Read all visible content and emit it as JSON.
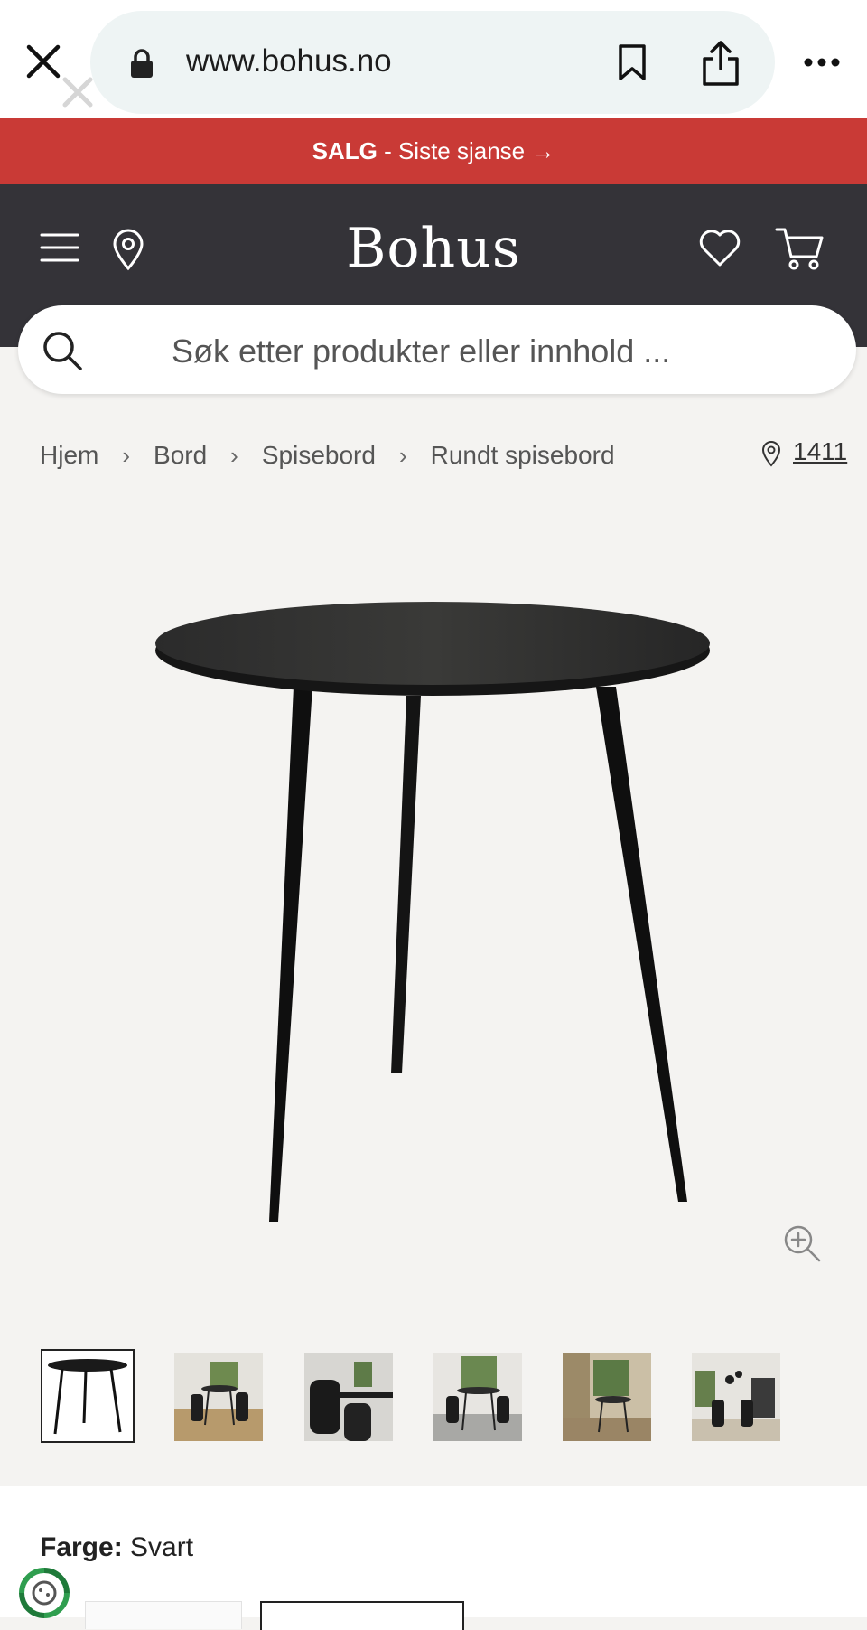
{
  "browser": {
    "url": "www.bohus.no",
    "icons": [
      "close-icon",
      "lock-icon",
      "bookmark-icon",
      "share-icon",
      "more-icon"
    ]
  },
  "banner": {
    "bold": "SALG",
    "text": " - Siste sjanse →",
    "color": "#c93a36"
  },
  "header": {
    "logo": "Bohus",
    "background": "#343338"
  },
  "search": {
    "placeholder": "Søk etter produkter eller innhold ..."
  },
  "breadcrumb": {
    "items": [
      "Hjem",
      "Bord",
      "Spisebord",
      "Rundt spisebord"
    ],
    "store": "1411"
  },
  "gallery": {
    "thumbnails": 6,
    "selected_index": 0
  },
  "product": {
    "color_label": "Farge:",
    "color_value": "Svart"
  }
}
